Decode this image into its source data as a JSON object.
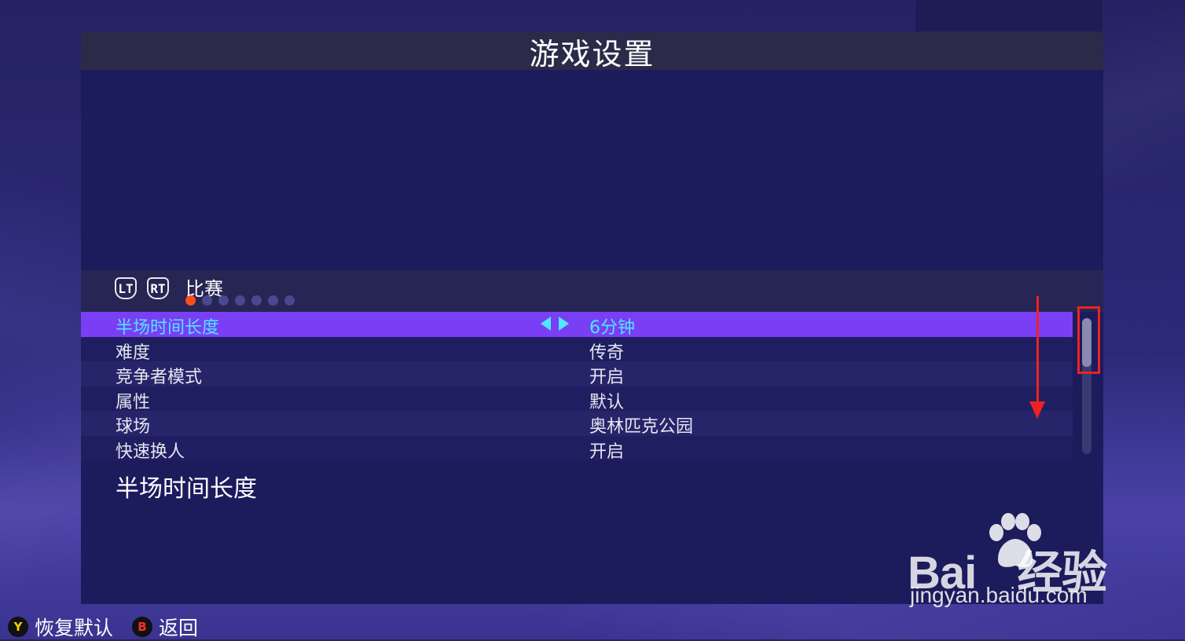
{
  "title": "游戏设置",
  "section": {
    "lt_label": "LT",
    "rt_label": "RT",
    "name": "比赛",
    "page_dots_total": 7,
    "page_dots_active_index": 0
  },
  "settings": [
    {
      "label": "半场时间长度",
      "value": "6分钟",
      "selected": true
    },
    {
      "label": "难度",
      "value": "传奇",
      "selected": false
    },
    {
      "label": "竞争者模式",
      "value": "开启",
      "selected": false
    },
    {
      "label": "属性",
      "value": "默认",
      "selected": false
    },
    {
      "label": "球场",
      "value": "奥林匹克公园",
      "selected": false
    },
    {
      "label": "快速换人",
      "value": "开启",
      "selected": false
    }
  ],
  "description_title": "半场时间长度",
  "footer": {
    "restore": {
      "button": "Y",
      "label": "恢复默认"
    },
    "back": {
      "button": "B",
      "label": "返回"
    }
  },
  "watermark": {
    "brand_left": "Bai",
    "brand_right": "经验",
    "url": "jingyan.baidu.com"
  },
  "colors": {
    "selected_row": "#7a3ff5",
    "selected_text": "#4ee8ff",
    "active_dot": "#ff4d1a",
    "annotation": "#ee2222"
  },
  "icons": [
    "bumper-lt-icon",
    "bumper-rt-icon",
    "arrow-left-icon",
    "arrow-right-icon",
    "y-button-icon",
    "b-button-icon",
    "paw-logo-icon"
  ]
}
